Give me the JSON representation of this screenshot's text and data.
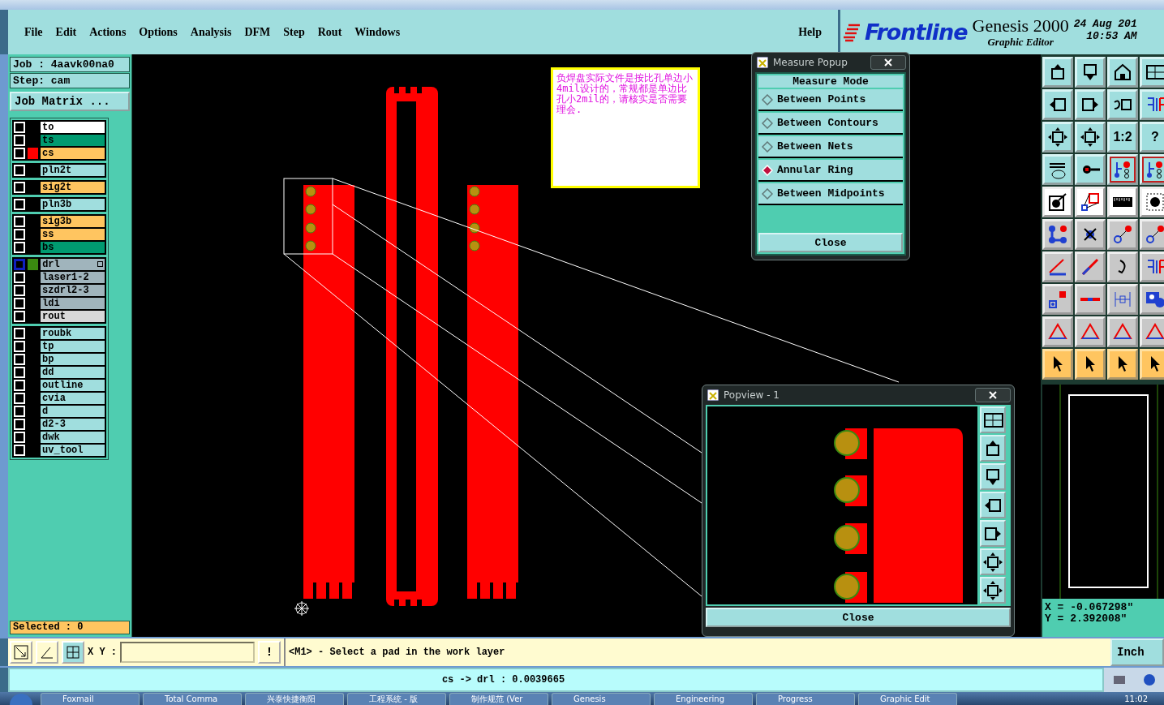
{
  "menu": {
    "items": [
      "File",
      "Edit",
      "Actions",
      "Options",
      "Analysis",
      "DFM",
      "Step",
      "Rout",
      "Windows"
    ],
    "help": "Help"
  },
  "brand": {
    "logo": "Frontline",
    "product": "Genesis 2000",
    "subtitle": "Graphic Editor",
    "date": "24 Aug 201",
    "time": "10:53 AM"
  },
  "job_panel": {
    "job": "Job : 4aavk00na0",
    "step": "Step: cam",
    "matrix_button": "Job Matrix ...",
    "selected_count": "Selected : 0"
  },
  "layer_groups": [
    {
      "layers": [
        {
          "name": "to",
          "color": "#ffffff",
          "selected": false
        },
        {
          "name": "ts",
          "color": "#009a70",
          "selected": false
        },
        {
          "name": "cs",
          "color": "#ffc560",
          "swatch": {
            "color": "#ff0000"
          },
          "selected": false
        }
      ]
    },
    {
      "layers": [
        {
          "name": "pln2t",
          "color": "#a0dede",
          "selected": false
        }
      ]
    },
    {
      "layers": [
        {
          "name": "sig2t",
          "color": "#ffc560",
          "selected": false
        }
      ]
    },
    {
      "layers": [
        {
          "name": "pln3b",
          "color": "#a0dede",
          "selected": false
        }
      ]
    },
    {
      "layers": [
        {
          "name": "sig3b",
          "color": "#ffc560",
          "selected": false
        },
        {
          "name": "ss",
          "color": "#ffc560",
          "selected": false
        },
        {
          "name": "bs",
          "color": "#009a70",
          "selected": false
        }
      ]
    },
    {
      "layers": [
        {
          "name": "drl",
          "color": "#a0b4bc",
          "swatch": {
            "color": "#3a8a10"
          },
          "selected": true
        },
        {
          "name": "laser1-2",
          "color": "#a0b4bc",
          "selected": false
        },
        {
          "name": "szdrl2-3",
          "color": "#a0b4bc",
          "selected": false
        },
        {
          "name": "ldi",
          "color": "#a0b4bc",
          "selected": false
        },
        {
          "name": "rout",
          "color": "#d8d8d8",
          "selected": false
        }
      ]
    },
    {
      "layers": [
        {
          "name": "roubk",
          "color": "#a0dede",
          "selected": false
        },
        {
          "name": "tp",
          "color": "#a0dede",
          "selected": false
        },
        {
          "name": "bp",
          "color": "#a0dede",
          "selected": false
        },
        {
          "name": "dd",
          "color": "#a0dede",
          "selected": false
        },
        {
          "name": "outline",
          "color": "#a0dede",
          "selected": false
        },
        {
          "name": "cvia",
          "color": "#a0dede",
          "selected": false
        },
        {
          "name": "d",
          "color": "#a0dede",
          "selected": false
        },
        {
          "name": "d2-3",
          "color": "#a0dede",
          "selected": false
        },
        {
          "name": "dwk",
          "color": "#a0dede",
          "selected": false
        },
        {
          "name": "uv_tool",
          "color": "#a0dede",
          "selected": false
        }
      ]
    }
  ],
  "note": {
    "text": "负焊盘实际文件是按比孔单边小4mil设计的，常规都是单边比孔小2mil的，请核实是否需要理会."
  },
  "measure_popup": {
    "title": "Measure Popup",
    "heading": "Measure Mode",
    "modes": [
      {
        "label": "Between Points",
        "selected": false
      },
      {
        "label": "Between Contours",
        "selected": false
      },
      {
        "label": "Between Nets",
        "selected": false
      },
      {
        "label": "Annular Ring",
        "selected": true
      },
      {
        "label": "Between Midpoints",
        "selected": false
      }
    ],
    "close": "Close"
  },
  "popview": {
    "title": "Popview - 1",
    "close": "Close"
  },
  "toolbar": {
    "texts": [
      "1:2",
      "?"
    ]
  },
  "coordinates": {
    "x": "X = -0.067298\"",
    "y": "Y = 2.392008\""
  },
  "command_bar": {
    "label": "X Y :",
    "alert": "!",
    "prompt": "<M1> - Select a pad in the work layer",
    "units": "Inch"
  },
  "status": "cs -> drl : 0.0039665",
  "taskbar": {
    "items": [
      "Foxmail",
      "Total Comma",
      "兴泰快捷衡阳",
      "工程系统 - 版",
      "制作规范 (Ver",
      "Genesis",
      "Engineering",
      "Progress",
      "Graphic Edit"
    ],
    "clock": "11:02"
  }
}
